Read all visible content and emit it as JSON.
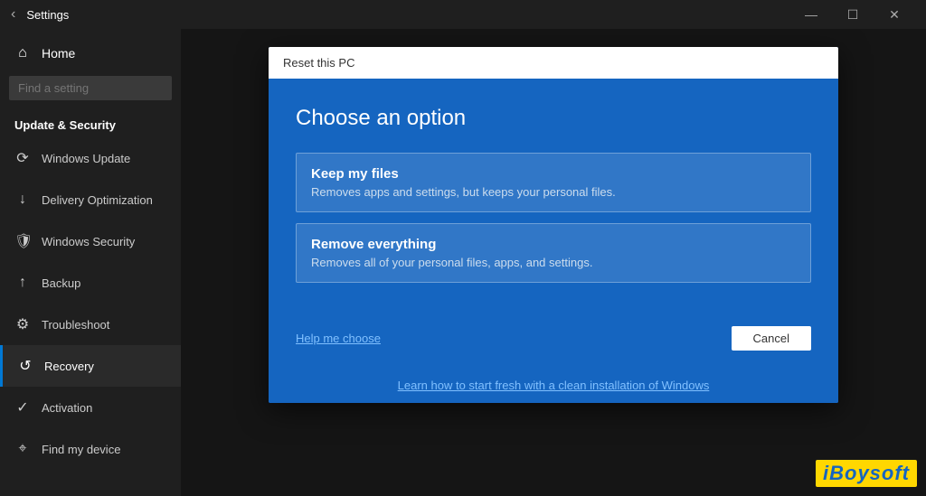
{
  "titlebar": {
    "back_label": "‹",
    "title": "Settings",
    "minimize_label": "—",
    "maximize_label": "☐",
    "close_label": "✕"
  },
  "sidebar": {
    "home_label": "Home",
    "search_placeholder": "Find a setting",
    "section_title": "Update & Security",
    "items": [
      {
        "id": "windows-update",
        "label": "Windows Update",
        "icon": "⟳"
      },
      {
        "id": "delivery-optimization",
        "label": "Delivery Optimization",
        "icon": "↓"
      },
      {
        "id": "windows-security",
        "label": "Windows Security",
        "icon": "🛡"
      },
      {
        "id": "backup",
        "label": "Backup",
        "icon": "↑"
      },
      {
        "id": "troubleshoot",
        "label": "Troubleshoot",
        "icon": "⚙"
      },
      {
        "id": "recovery",
        "label": "Recovery",
        "icon": "↺"
      },
      {
        "id": "activation",
        "label": "Activation",
        "icon": "✓"
      },
      {
        "id": "find-my-device",
        "label": "Find my device",
        "icon": "⌖"
      }
    ]
  },
  "dialog": {
    "titlebar_label": "Reset this PC",
    "heading": "Choose an option",
    "option1": {
      "title": "Keep my files",
      "description": "Removes apps and settings, but keeps your personal files."
    },
    "option2": {
      "title": "Remove everything",
      "description": "Removes all of your personal files, apps, and settings."
    },
    "help_link": "Help me choose",
    "cancel_label": "Cancel"
  },
  "bottom": {
    "link_text": "Learn how to start fresh with a clean installation of Windows"
  },
  "branding": {
    "logo": "iBoysoft"
  }
}
